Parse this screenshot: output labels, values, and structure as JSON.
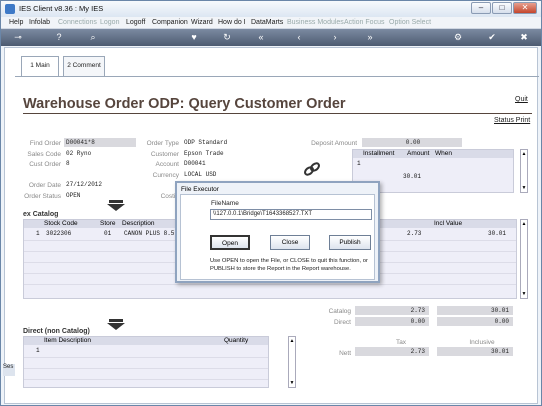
{
  "window": {
    "title": "IES Client v8.36 : My IES",
    "min": "–",
    "max": "□",
    "close": "✕"
  },
  "menu": [
    "Help",
    "Infolab",
    "Connections",
    "Logon",
    "Logoff",
    "Companion",
    "Wizard",
    "How do I",
    "DataMarts",
    "Business Modules",
    "Action Focus",
    "Option Select"
  ],
  "menu_disabled": [
    false,
    false,
    true,
    true,
    false,
    false,
    false,
    false,
    false,
    true,
    true,
    true
  ],
  "toolbar_icons": [
    "key-icon",
    "help-icon",
    "search-icon",
    "heart-icon",
    "refresh-icon",
    "first-icon",
    "previous-icon",
    "next-icon",
    "last-icon",
    "gear-icon",
    "check-icon",
    "close-icon"
  ],
  "tabs": {
    "main": "1 Main",
    "comment": "2 Comment"
  },
  "page": {
    "title": "Warehouse Order ODP: Query Customer Order",
    "quit": "Quit",
    "status_print": "Status Print"
  },
  "header_fields": {
    "find_order_label": "Find Order",
    "find_order": "D00041*8",
    "sales_code_label": "Sales Code",
    "sales_code": "02 Ryno",
    "cust_order_label": "Cust Order",
    "cust_order": "8",
    "order_date_label": "Order Date",
    "order_date": "27/12/2012",
    "order_status_label": "Order Status",
    "order_status": "OPEN",
    "order_type_label": "Order Type",
    "order_type": "ODP Standard",
    "customer_label": "Customer",
    "customer": "Epson Trade",
    "account_label": "Account",
    "account": "D00041",
    "currency_label": "Currency",
    "currency": "LOCAL USD",
    "costing_label": "Costin",
    "deposit_amount_label": "Deposit Amount",
    "deposit_amount": "0.00"
  },
  "installments": {
    "columns": [
      "Installment",
      "Amount",
      "When"
    ],
    "rows": [
      {
        "num": "1"
      }
    ],
    "side_value": "30.01"
  },
  "catalog": {
    "heading": "ex Catalog",
    "columns": [
      "Stock Code",
      "Store",
      "Description",
      "Incl Value"
    ],
    "rows": [
      {
        "num": "1",
        "stock_code": "3022306",
        "store": "01",
        "description": "CANON PLUS 8.5",
        "unit_value": "2.73",
        "incl_value": "30.01"
      }
    ]
  },
  "totals": {
    "catalog_label": "Catalog",
    "catalog_excl": "2.73",
    "catalog_incl": "30.01",
    "direct_label": "Direct",
    "direct_excl": "0.00",
    "direct_incl": "0.00",
    "tax_label": "Tax",
    "inclusive_label": "Inclusive",
    "nett_label": "Nett",
    "nett_tax": "2.73",
    "nett_incl": "30.01"
  },
  "direct": {
    "heading": "Direct (non Catalog)",
    "columns": [
      "Item Description",
      "Quantity"
    ],
    "rows": [
      {
        "num": "1"
      }
    ]
  },
  "left_cut_text": "Ses",
  "dialog": {
    "title": "File Executor",
    "filename_label": "FileName",
    "filename": "\\\\127.0.0.1\\Bridge\\T1643368527.TXT",
    "open": "Open",
    "close": "Close",
    "publish": "Publish",
    "help": "Use OPEN to open the File, or CLOSE to quit this function, or PUBLISH to store the Report in the Report warehouse."
  },
  "colors": {
    "title_brown": "#56453d",
    "toolbar": "#5c6a80",
    "grid_bg": "#eeeef8",
    "field_grey": "#d9d9de"
  }
}
